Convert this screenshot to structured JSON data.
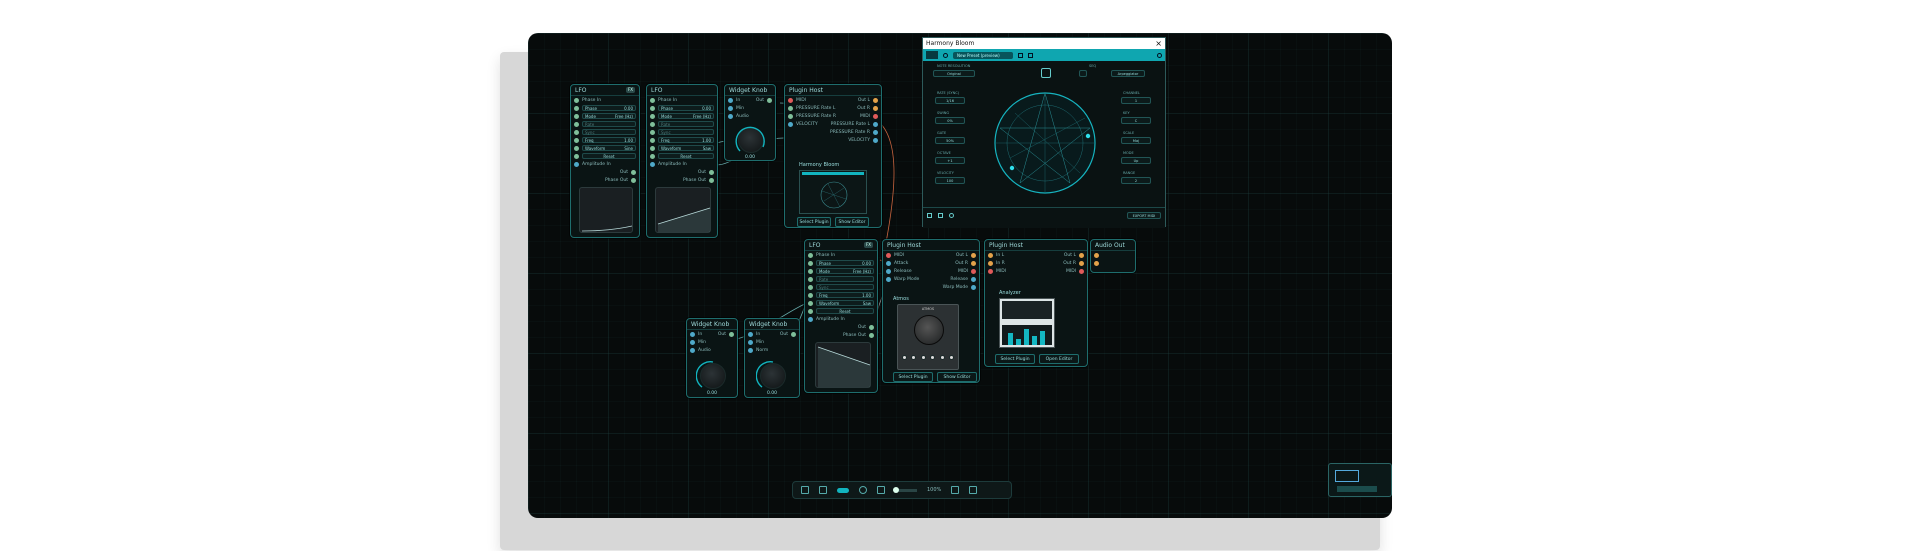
{
  "plugin_window": {
    "title": "Harmony Bloom",
    "close_glyph": "×",
    "preset_name": "New Preset (preview)",
    "labels": {
      "pitch_grid_left_top": "NOTE RESOLUTION",
      "preset_select": "Original",
      "knob_1": "SEQ",
      "knob_1_val": "Arpeggiator",
      "left_1": "RATE (SYNC)",
      "left_1_val": "1/16",
      "left_2": "SWING",
      "left_2_val": "0%",
      "left_3": "GATE",
      "left_3_val": "50%",
      "left_4": "OCTAVE",
      "left_4_val": "+1",
      "left_5": "VELOCITY",
      "left_5_val": "100",
      "right_1": "CHANNEL",
      "right_1_val": "1",
      "right_2": "KEY",
      "right_2_val": "C",
      "right_3": "SCALE",
      "right_3_val": "Maj",
      "right_4": "MODE",
      "right_4_val": "Up",
      "right_5": "RANGE",
      "right_5_val": "2",
      "bottom_button": "EXPORT MIDI"
    }
  },
  "nodes": {
    "lfo_a": {
      "title": "LFO",
      "badge": "FX",
      "rows": [
        {
          "label": "Phase In",
          "dot": "g"
        },
        {
          "label": "Phase",
          "value": "0.00",
          "dot": "g"
        },
        {
          "label": "Mode",
          "value": "Free (Hz)",
          "dot": "g"
        },
        {
          "label": "Rate",
          "dot": "g"
        },
        {
          "label": "Sync",
          "dot": "g"
        },
        {
          "label": "Freq",
          "value": "1.00",
          "dot": "g"
        },
        {
          "label": "Waveform",
          "value": "Sine",
          "dot": "g"
        },
        {
          "label": "Reset",
          "dot": "g"
        },
        {
          "label": "Amplitude In",
          "dot": "b"
        }
      ],
      "out_1": "Out",
      "out_2": "Phase Out"
    },
    "lfo_b": {
      "title": "LFO",
      "rows": [
        {
          "label": "Phase In",
          "dot": "g"
        },
        {
          "label": "Phase",
          "value": "0.00",
          "dot": "g"
        },
        {
          "label": "Mode",
          "value": "Free (Hz)",
          "dot": "g"
        },
        {
          "label": "Rate",
          "dot": "g"
        },
        {
          "label": "Sync",
          "dot": "g"
        },
        {
          "label": "Freq",
          "value": "1.00",
          "dot": "g"
        },
        {
          "label": "Waveform",
          "value": "Saw",
          "dot": "g"
        },
        {
          "label": "Reset",
          "dot": "g"
        },
        {
          "label": "Amplitude In",
          "dot": "b"
        }
      ],
      "out_1": "Out",
      "out_2": "Phase Out"
    },
    "widget_knob_a": {
      "title": "Widget Knob",
      "rows": [
        {
          "label": "In"
        },
        {
          "label": "Min"
        },
        {
          "label": "Audio"
        }
      ],
      "out": "Out",
      "value": "0.00"
    },
    "plugin_host_a": {
      "title": "Plugin Host",
      "rows": [
        {
          "label": "MIDI",
          "dot": "r",
          "out": "Out L"
        },
        {
          "label": "PRESSURE Rate L",
          "dot": "g",
          "out": "Out R"
        },
        {
          "label": "PRESSURE Rate R",
          "dot": "g",
          "out": "MIDI"
        },
        {
          "label": "VELOCITY",
          "dot": "b",
          "out": "PRESSURE Rate L"
        },
        {
          "out": "PRESSURE Rate R"
        },
        {
          "out": "VELOCITY"
        }
      ],
      "plugin_name": "Harmony Bloom",
      "btn_select": "Select Plugin",
      "btn_show": "Show Editor"
    },
    "lfo_c": {
      "title": "LFO",
      "badge": "FX",
      "rows": [
        {
          "label": "Phase In",
          "dot": "g"
        },
        {
          "label": "Phase",
          "value": "0.00",
          "dot": "g"
        },
        {
          "label": "Mode",
          "value": "Free (Hz)",
          "dot": "g"
        },
        {
          "label": "Rate",
          "dot": "g"
        },
        {
          "label": "Sync",
          "dot": "g"
        },
        {
          "label": "Freq",
          "value": "1.00",
          "dot": "g"
        },
        {
          "label": "Waveform",
          "value": "Saw",
          "dot": "g"
        },
        {
          "label": "Reset",
          "dot": "g"
        },
        {
          "label": "Amplitude In",
          "dot": "b"
        }
      ],
      "out_1": "Out",
      "out_2": "Phase Out"
    },
    "plugin_host_b": {
      "title": "Plugin Host",
      "rows": [
        {
          "label": "MIDI",
          "dot": "r",
          "out": "Out L"
        },
        {
          "label": "Attack",
          "dot": "b",
          "out": "Out R"
        },
        {
          "label": "Release",
          "dot": "b",
          "out": "MIDI"
        },
        {
          "label": "Warp Mode",
          "dot": "b",
          "out": "Release"
        },
        {
          "out": "Warp Mode"
        }
      ],
      "plugin_name": "Atmos",
      "device_label": "ATMOS",
      "btn_select": "Select Plugin",
      "btn_show": "Show Editor"
    },
    "plugin_host_c": {
      "title": "Plugin Host",
      "rows": [
        {
          "label": "In L",
          "dot": "o",
          "out": "Out L"
        },
        {
          "label": "In R",
          "dot": "o",
          "out": "Out R"
        },
        {
          "label": "MIDI",
          "dot": "r",
          "out": "MIDI"
        }
      ],
      "plugin_name": "Analyzer",
      "btn_select": "Select Plugin",
      "btn_show": "Open Editor"
    },
    "audio_out": {
      "title": "Audio Out",
      "rows": [
        {
          "dot": "o"
        },
        {
          "dot": "o"
        }
      ]
    },
    "widget_knob_b": {
      "title": "Widget Knob",
      "rows": [
        {
          "label": "In"
        },
        {
          "label": "Min"
        },
        {
          "label": "Audio"
        }
      ],
      "out": "Out",
      "value": "0.00"
    },
    "widget_knob_c": {
      "title": "Widget Knob",
      "rows": [
        {
          "label": "In"
        },
        {
          "label": "Min"
        },
        {
          "label": "Norm"
        }
      ],
      "out": "Out",
      "value": "0.00"
    }
  },
  "toolbar": {
    "zoom_label": "100%"
  },
  "colors": {
    "accent": "#12b4bf",
    "canvas": "#070b0b",
    "node_border": "#1e6d6d"
  }
}
